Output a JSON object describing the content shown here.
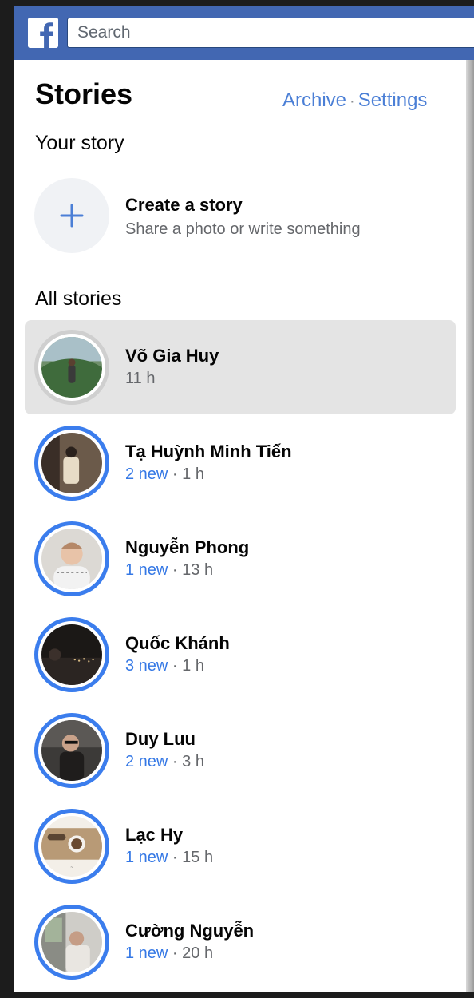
{
  "header": {
    "search_placeholder": "Search",
    "brand_color": "#4267b2"
  },
  "page": {
    "title": "Stories",
    "archive_label": "Archive",
    "separator": "·",
    "settings_label": "Settings"
  },
  "your_story": {
    "heading": "Your story",
    "create_title": "Create a story",
    "create_subtitle": "Share a photo or write something",
    "icon": "plus-icon"
  },
  "all_stories": {
    "heading": "All stories",
    "items": [
      {
        "name": "Võ Gia Huy",
        "new_count": "",
        "sep": "",
        "time": "11 h",
        "seen": true
      },
      {
        "name": "Tạ Huỳnh Minh Tiến",
        "new_count": "2 new",
        "sep": " · ",
        "time": "1 h",
        "seen": false
      },
      {
        "name": "Nguyễn Phong",
        "new_count": "1 new",
        "sep": " · ",
        "time": "13 h",
        "seen": false
      },
      {
        "name": "Quốc Khánh",
        "new_count": "3 new",
        "sep": " · ",
        "time": "1 h",
        "seen": false
      },
      {
        "name": "Duy Luu",
        "new_count": "2 new",
        "sep": " · ",
        "time": "3 h",
        "seen": false
      },
      {
        "name": "Lạc Hy",
        "new_count": "1 new",
        "sep": " · ",
        "time": "15 h",
        "seen": false
      },
      {
        "name": "Cường Nguyễn",
        "new_count": "1 new",
        "sep": " · ",
        "time": "20 h",
        "seen": false
      }
    ]
  },
  "colors": {
    "link": "#4b7fd6",
    "unseen_ring": "#3b7ded",
    "seen_ring": "#cfcfcf",
    "selected_row": "#e4e4e4"
  }
}
